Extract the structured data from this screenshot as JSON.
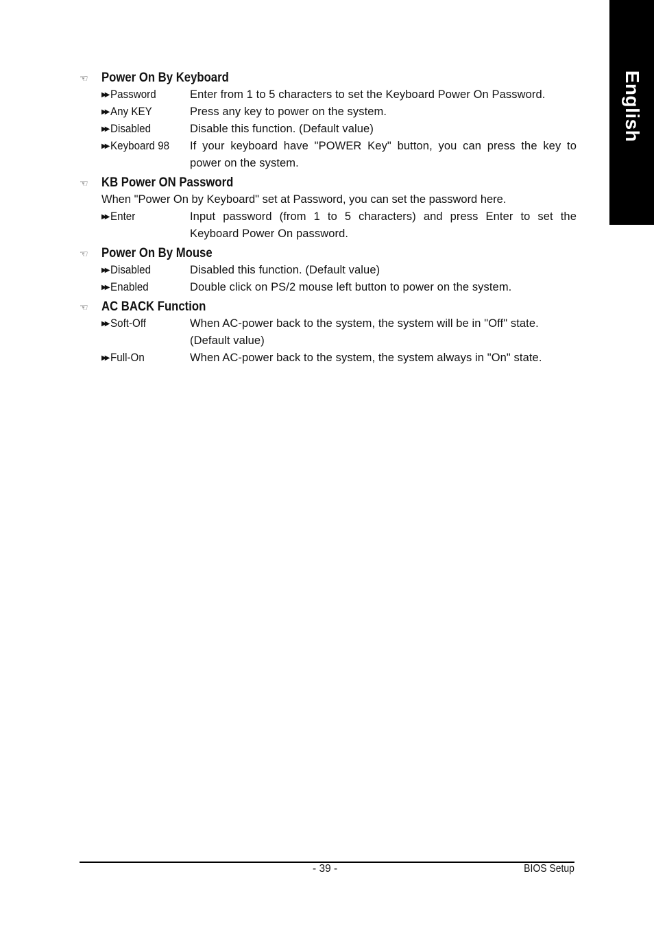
{
  "side_tab": {
    "label": "English",
    "color": "#000000"
  },
  "sections": [
    {
      "title": "Power On By Keyboard",
      "intro": null,
      "options": [
        {
          "label": "Password",
          "desc": "Enter from 1 to 5 characters to set the Keyboard Power On Password."
        },
        {
          "label": "Any KEY",
          "desc": "Press any key to power on the system."
        },
        {
          "label": "Disabled",
          "desc": "Disable this function. (Default value)"
        },
        {
          "label": "Keyboard 98",
          "desc": "If your keyboard have \"POWER Key\" button, you can press the key to power on the system."
        }
      ]
    },
    {
      "title": "KB Power ON Password",
      "intro": "When \"Power On by Keyboard\" set at Password, you can set the password here.",
      "options": [
        {
          "label": "Enter",
          "desc": "Input password (from 1 to 5 characters) and press Enter to set the Keyboard Power On password."
        }
      ]
    },
    {
      "title": "Power On By Mouse",
      "intro": null,
      "options": [
        {
          "label": "Disabled",
          "desc": "Disabled this function. (Default value)"
        },
        {
          "label": "Enabled",
          "desc": "Double click on PS/2 mouse left button to power on the system."
        }
      ]
    },
    {
      "title": "AC BACK Function",
      "intro": null,
      "options": [
        {
          "label": "Soft-Off",
          "desc": "When AC-power back to the system, the system will be in \"Off\" state. (Default value)"
        },
        {
          "label": "Full-On",
          "desc": "When AC-power back to the system, the system always in \"On\" state."
        }
      ]
    }
  ],
  "footer": {
    "page_number": "- 39 -",
    "section_title": "BIOS Setup"
  },
  "icons": {
    "section_bullet": "pointing-hand-icon",
    "option_bullet": "double-arrow-icon"
  }
}
